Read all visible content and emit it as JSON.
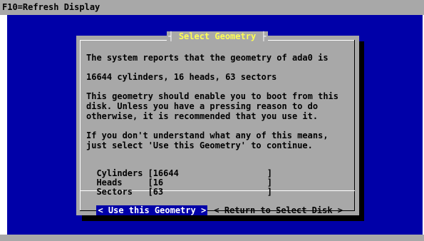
{
  "topbar": {
    "hint": "F10=Refresh Display"
  },
  "dialog": {
    "title": "Select Geometry",
    "title_left_glyph": "┤",
    "title_right_glyph": "├",
    "line1": "The system reports that the geometry of ada0 is",
    "line2": "16644 cylinders, 16 heads, 63 sectors",
    "line3": "This geometry should enable you to boot from this",
    "line4": "disk. Unless you have a pressing reason to do",
    "line5": "otherwise, it is recommended that you use it.",
    "line6": "If you don't understand what any of this means,",
    "line7": "just select 'Use this Geometry' to continue."
  },
  "fields": [
    {
      "label": "Cylinders",
      "value": "16644"
    },
    {
      "label": "Heads",
      "value": "16"
    },
    {
      "label": "Sectors",
      "value": "63"
    }
  ],
  "buttons": {
    "use": "< Use this Geometry >",
    "return": "< Return to Select Disk >"
  },
  "colors": {
    "background": "#0000a8",
    "dialog": "#a8a8a8",
    "title": "#ffff54",
    "selected_button_bg": "#0000a8",
    "selected_button_fg": "#ffffff"
  }
}
